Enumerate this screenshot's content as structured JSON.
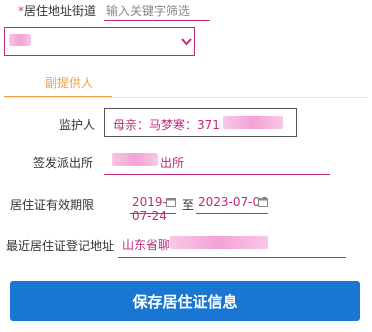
{
  "street": {
    "required_mark": "*",
    "label": "居住地址街道",
    "search_placeholder": "输入关键字筛选"
  },
  "tabs": {
    "active_label": "副提供人"
  },
  "guardian": {
    "label": "监护人",
    "value_prefix": "母亲：马梦寒：371"
  },
  "police_station": {
    "label": "签发派出所",
    "value_suffix": "出所"
  },
  "validity": {
    "label": "居住证有效期限",
    "start": "2019-07-24",
    "separator": "至",
    "end": "2023-07-06"
  },
  "recent_address": {
    "label": "最近居住证登记地址",
    "value_prefix": "山东省聊"
  },
  "save_button": {
    "label": "保存居住证信息"
  },
  "colors": {
    "accent_pink": "#c12a7a",
    "tab_orange": "#f0a040",
    "primary_blue": "#1976d2"
  }
}
